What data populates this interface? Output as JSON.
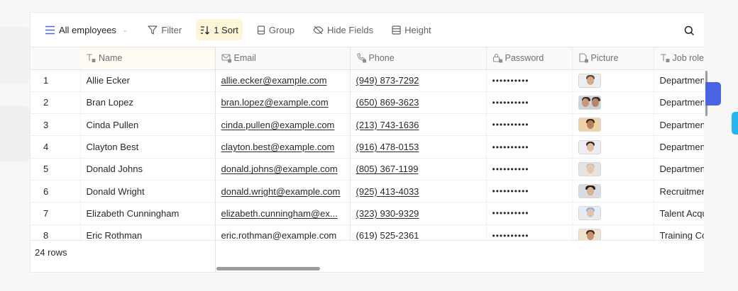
{
  "toolbar": {
    "view_label": "All employees",
    "filter_label": "Filter",
    "sort_label": "1 Sort",
    "group_label": "Group",
    "hide_fields_label": "Hide Fields",
    "height_label": "Height"
  },
  "table": {
    "columns": [
      "Name",
      "Email",
      "Phone",
      "Password",
      "Picture",
      "Job role"
    ],
    "rows": [
      {
        "index": "1",
        "name": "Allie Ecker",
        "email": "allie.ecker@example.com",
        "phone": "(949) 873-7292",
        "password": "••••••••••",
        "job_role": "Departmen"
      },
      {
        "index": "2",
        "name": "Bran Lopez",
        "email": "bran.lopez@example.com",
        "phone": "(650) 869-3623",
        "password": "••••••••••",
        "job_role": "Departmen"
      },
      {
        "index": "3",
        "name": "Cinda Pullen",
        "email": "cinda.pullen@example.com",
        "phone": "(213) 743-1636",
        "password": "••••••••••",
        "job_role": "Department"
      },
      {
        "index": "4",
        "name": "Clayton Best",
        "email": "clayton.best@example.com",
        "phone": "(916) 478-0153",
        "password": "••••••••••",
        "job_role": "Department"
      },
      {
        "index": "5",
        "name": "Donald Johns",
        "email": "donald.johns@example.com",
        "phone": "(805) 367-1199",
        "password": "••••••••••",
        "job_role": "Department"
      },
      {
        "index": "6",
        "name": "Donald Wright",
        "email": "donald.wright@example.com",
        "phone": "(925) 413-4033",
        "password": "••••••••••",
        "job_role": "Recruitmen"
      },
      {
        "index": "7",
        "name": "Elizabeth Cunningham",
        "email": "elizabeth.cunningham@ex...",
        "phone": "(323) 930-9329",
        "password": "••••••••••",
        "job_role": "Talent Acqu"
      },
      {
        "index": "8",
        "name": "Eric Rothman",
        "email": "eric.rothman@example.com",
        "phone": "(619) 525-2361",
        "password": "••••••••••",
        "job_role": "Training Co"
      }
    ]
  },
  "footer": {
    "row_count": "24 rows"
  },
  "colors": {
    "accent": "#4a63e0",
    "sort_highlight": "#fff6d9",
    "cyan_tab": "#27b6f0"
  }
}
